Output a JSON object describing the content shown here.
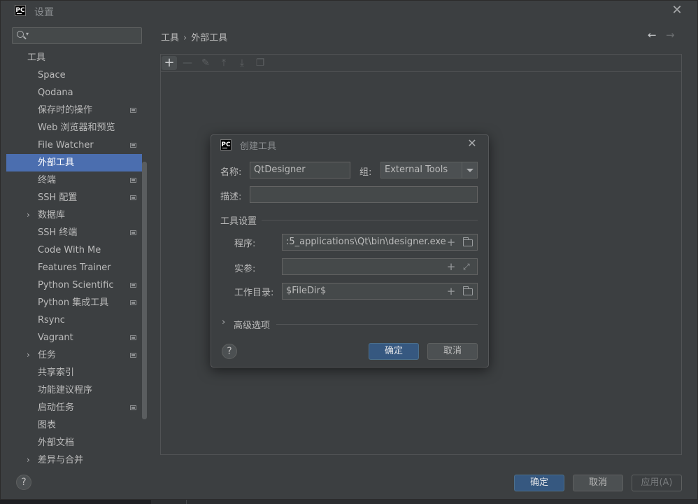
{
  "window": {
    "logo": "PC",
    "title": "设置",
    "close_glyph": "✕"
  },
  "search": {
    "placeholder": "",
    "value": ""
  },
  "sidebar": {
    "items": [
      {
        "label": "工具",
        "root": true,
        "selected": false,
        "has_chevron": false,
        "has_config": false
      },
      {
        "label": "Space",
        "selected": false,
        "has_chevron": false,
        "has_config": false
      },
      {
        "label": "Qodana",
        "selected": false,
        "has_chevron": false,
        "has_config": false
      },
      {
        "label": "保存时的操作",
        "selected": false,
        "has_chevron": false,
        "has_config": true
      },
      {
        "label": "Web 浏览器和预览",
        "selected": false,
        "has_chevron": false,
        "has_config": false
      },
      {
        "label": "File Watcher",
        "selected": false,
        "has_chevron": false,
        "has_config": true
      },
      {
        "label": "外部工具",
        "selected": true,
        "has_chevron": false,
        "has_config": false
      },
      {
        "label": "终端",
        "selected": false,
        "has_chevron": false,
        "has_config": true
      },
      {
        "label": "SSH 配置",
        "selected": false,
        "has_chevron": false,
        "has_config": true
      },
      {
        "label": "数据库",
        "selected": false,
        "has_chevron": true,
        "has_config": false
      },
      {
        "label": "SSH 终端",
        "selected": false,
        "has_chevron": false,
        "has_config": true
      },
      {
        "label": "Code With Me",
        "selected": false,
        "has_chevron": false,
        "has_config": false
      },
      {
        "label": "Features Trainer",
        "selected": false,
        "has_chevron": false,
        "has_config": false
      },
      {
        "label": "Python Scientific",
        "selected": false,
        "has_chevron": false,
        "has_config": true
      },
      {
        "label": "Python 集成工具",
        "selected": false,
        "has_chevron": false,
        "has_config": true
      },
      {
        "label": "Rsync",
        "selected": false,
        "has_chevron": false,
        "has_config": false
      },
      {
        "label": "Vagrant",
        "selected": false,
        "has_chevron": false,
        "has_config": true
      },
      {
        "label": "任务",
        "selected": false,
        "has_chevron": true,
        "has_config": true
      },
      {
        "label": "共享索引",
        "selected": false,
        "has_chevron": false,
        "has_config": false
      },
      {
        "label": "功能建议程序",
        "selected": false,
        "has_chevron": false,
        "has_config": false
      },
      {
        "label": "启动任务",
        "selected": false,
        "has_chevron": false,
        "has_config": true
      },
      {
        "label": "图表",
        "selected": false,
        "has_chevron": false,
        "has_config": false
      },
      {
        "label": "外部文档",
        "selected": false,
        "has_chevron": false,
        "has_config": false
      },
      {
        "label": "差异与合并",
        "selected": false,
        "has_chevron": true,
        "has_config": false
      }
    ]
  },
  "breadcrumb": {
    "parent": "工具",
    "separator": "›",
    "current": "外部工具"
  },
  "nav": {
    "back": "←",
    "forward": "→"
  },
  "toolbar": {
    "add": "+",
    "remove": "—",
    "edit": "✎",
    "move_up": "⤒",
    "move_down": "⤓",
    "copy": "❐"
  },
  "dialog": {
    "logo": "PC",
    "title": "创建工具",
    "close_glyph": "✕",
    "name_label": "名称:",
    "name_value": "QtDesigner",
    "group_label": "组:",
    "group_value": "External Tools",
    "description_label": "描述:",
    "description_value": "",
    "tool_settings_section": "工具设置",
    "program_label": "程序:",
    "program_value": ":5_applications\\Qt\\bin\\designer.exe",
    "arguments_label": "实参:",
    "arguments_value": "",
    "workdir_label": "工作目录:",
    "workdir_value": "$FileDir$",
    "advanced_section": "高级选项",
    "advanced_chevron": "›",
    "help": "?",
    "ok": "确定",
    "cancel": "取消"
  },
  "footer": {
    "help": "?",
    "ok": "确定",
    "cancel": "取消",
    "apply": "应用(A)"
  },
  "icons": {
    "plus": "+",
    "expand": "⤢"
  }
}
